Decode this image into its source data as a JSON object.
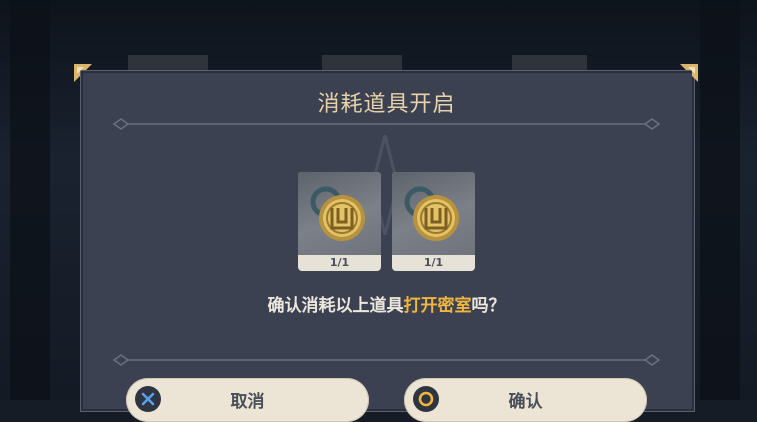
{
  "dialog": {
    "title": "消耗道具开启",
    "items": [
      {
        "icon": "golden-key-medallion-icon",
        "count": "1/1"
      },
      {
        "icon": "golden-key-medallion-icon",
        "count": "1/1"
      }
    ],
    "question": {
      "prefix": "确认消耗以上道具",
      "highlight": "打开密室",
      "suffix": "吗？"
    },
    "buttons": {
      "cancel": {
        "label": "取消",
        "icon": "x-circle-icon"
      },
      "confirm": {
        "label": "确认",
        "icon": "ring-circle-icon"
      }
    },
    "colors": {
      "panel": "#3b4150",
      "title": "#e7d2ab",
      "highlight": "#f0b640",
      "button": "#ece5d5"
    }
  }
}
